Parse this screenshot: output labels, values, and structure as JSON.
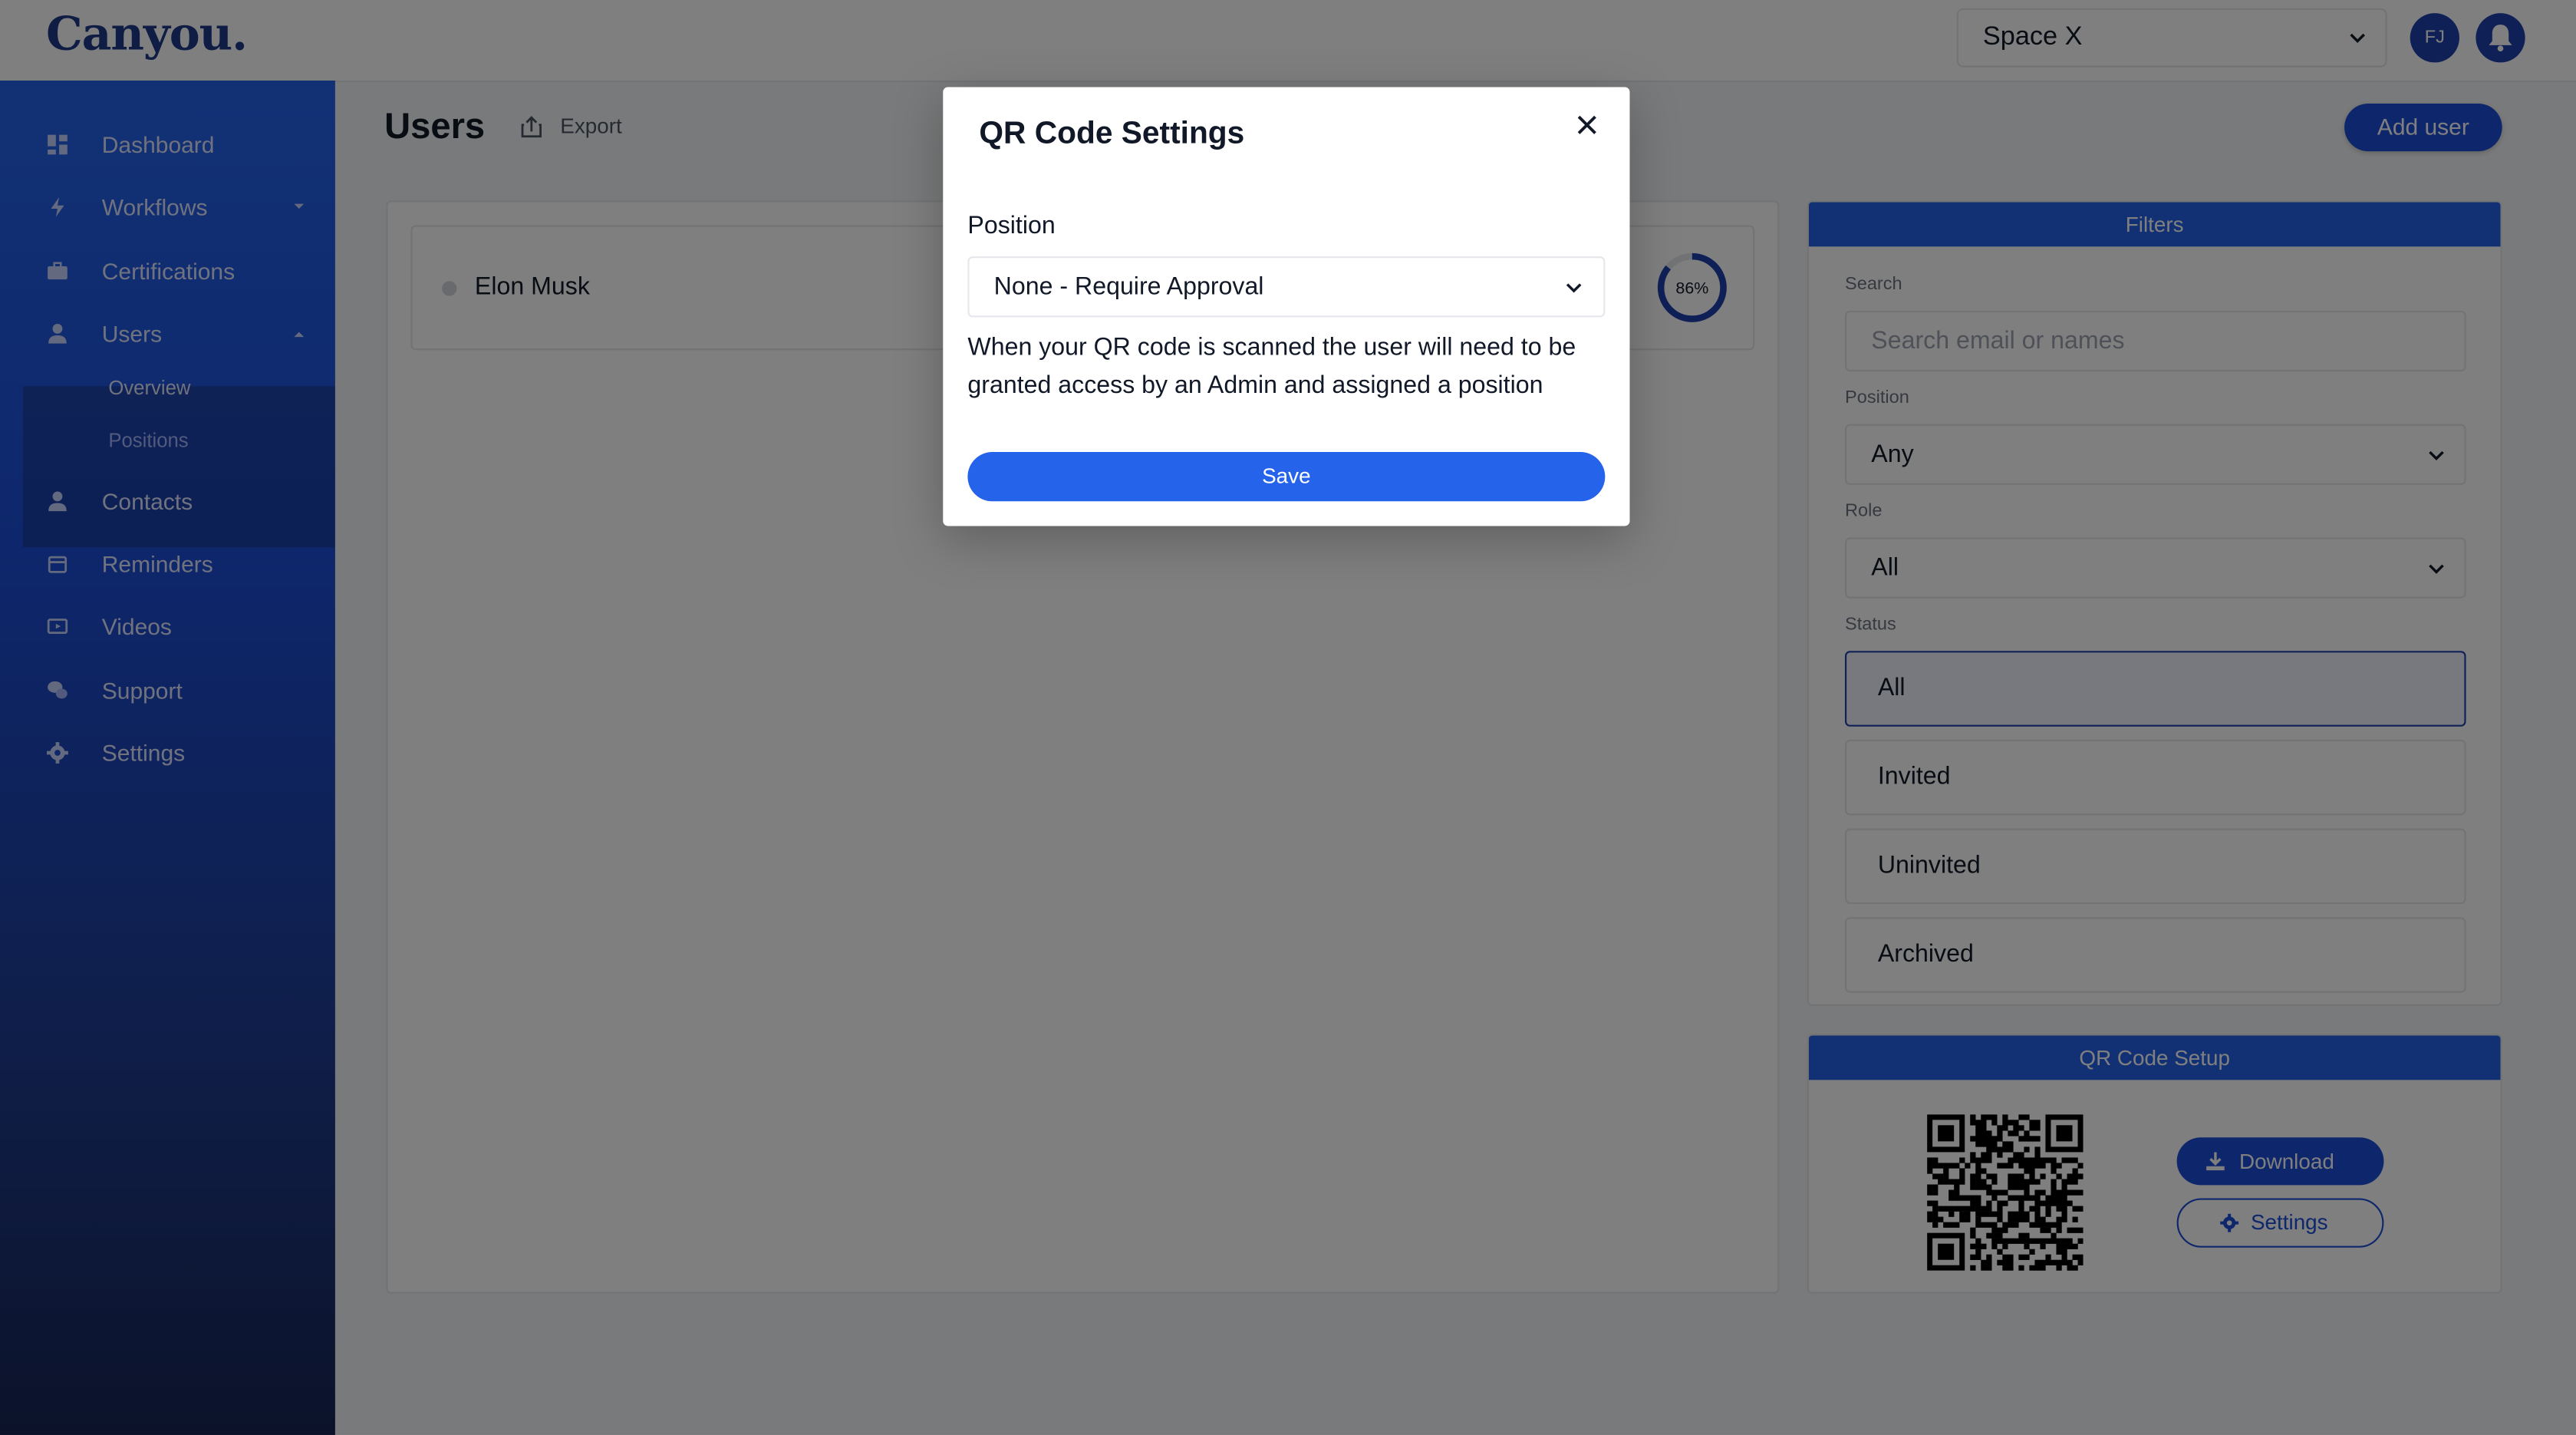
{
  "app": {
    "logo": "Canyou."
  },
  "header": {
    "space_selected": "Space X",
    "avatar_initials": "FJ"
  },
  "sidebar": {
    "items": [
      {
        "label": "Dashboard",
        "icon": "dashboard-icon"
      },
      {
        "label": "Workflows",
        "icon": "bolt-icon"
      },
      {
        "label": "Certifications",
        "icon": "briefcase-icon"
      },
      {
        "label": "Users",
        "icon": "user-icon"
      },
      {
        "label": "Contacts",
        "icon": "user-icon"
      },
      {
        "label": "Reminders",
        "icon": "calendar-icon"
      },
      {
        "label": "Videos",
        "icon": "video-icon"
      },
      {
        "label": "Support",
        "icon": "chat-icon"
      },
      {
        "label": "Settings",
        "icon": "gear-icon"
      }
    ],
    "users_sub": [
      "Overview",
      "Positions"
    ]
  },
  "main": {
    "title": "Users",
    "export_label": "Export",
    "add_user_label": "Add user",
    "users": [
      {
        "name": "Elon Musk",
        "progress_label": "86%",
        "progress": 0.86
      }
    ]
  },
  "filters": {
    "header": "Filters",
    "search_label": "Search",
    "search_placeholder": "Search email or names",
    "position_label": "Position",
    "position_value": "Any",
    "role_label": "Role",
    "role_value": "All",
    "status_label": "Status",
    "status_options": [
      "All",
      "Invited",
      "Uninvited",
      "Archived"
    ],
    "status_selected": "All"
  },
  "qr_setup": {
    "header": "QR Code Setup",
    "download_label": "Download",
    "settings_label": "Settings"
  },
  "modal": {
    "title": "QR Code Settings",
    "position_label": "Position",
    "position_value": "None - Require Approval",
    "help_text": "When your QR code is scanned the user will need to be granted access by an Admin and assigned a position",
    "save_label": "Save"
  },
  "colors": {
    "accent": "#2563eb",
    "brand_dark": "#1e3a8a",
    "sidebar_top": "#2563eb",
    "sidebar_bottom": "#172554"
  }
}
